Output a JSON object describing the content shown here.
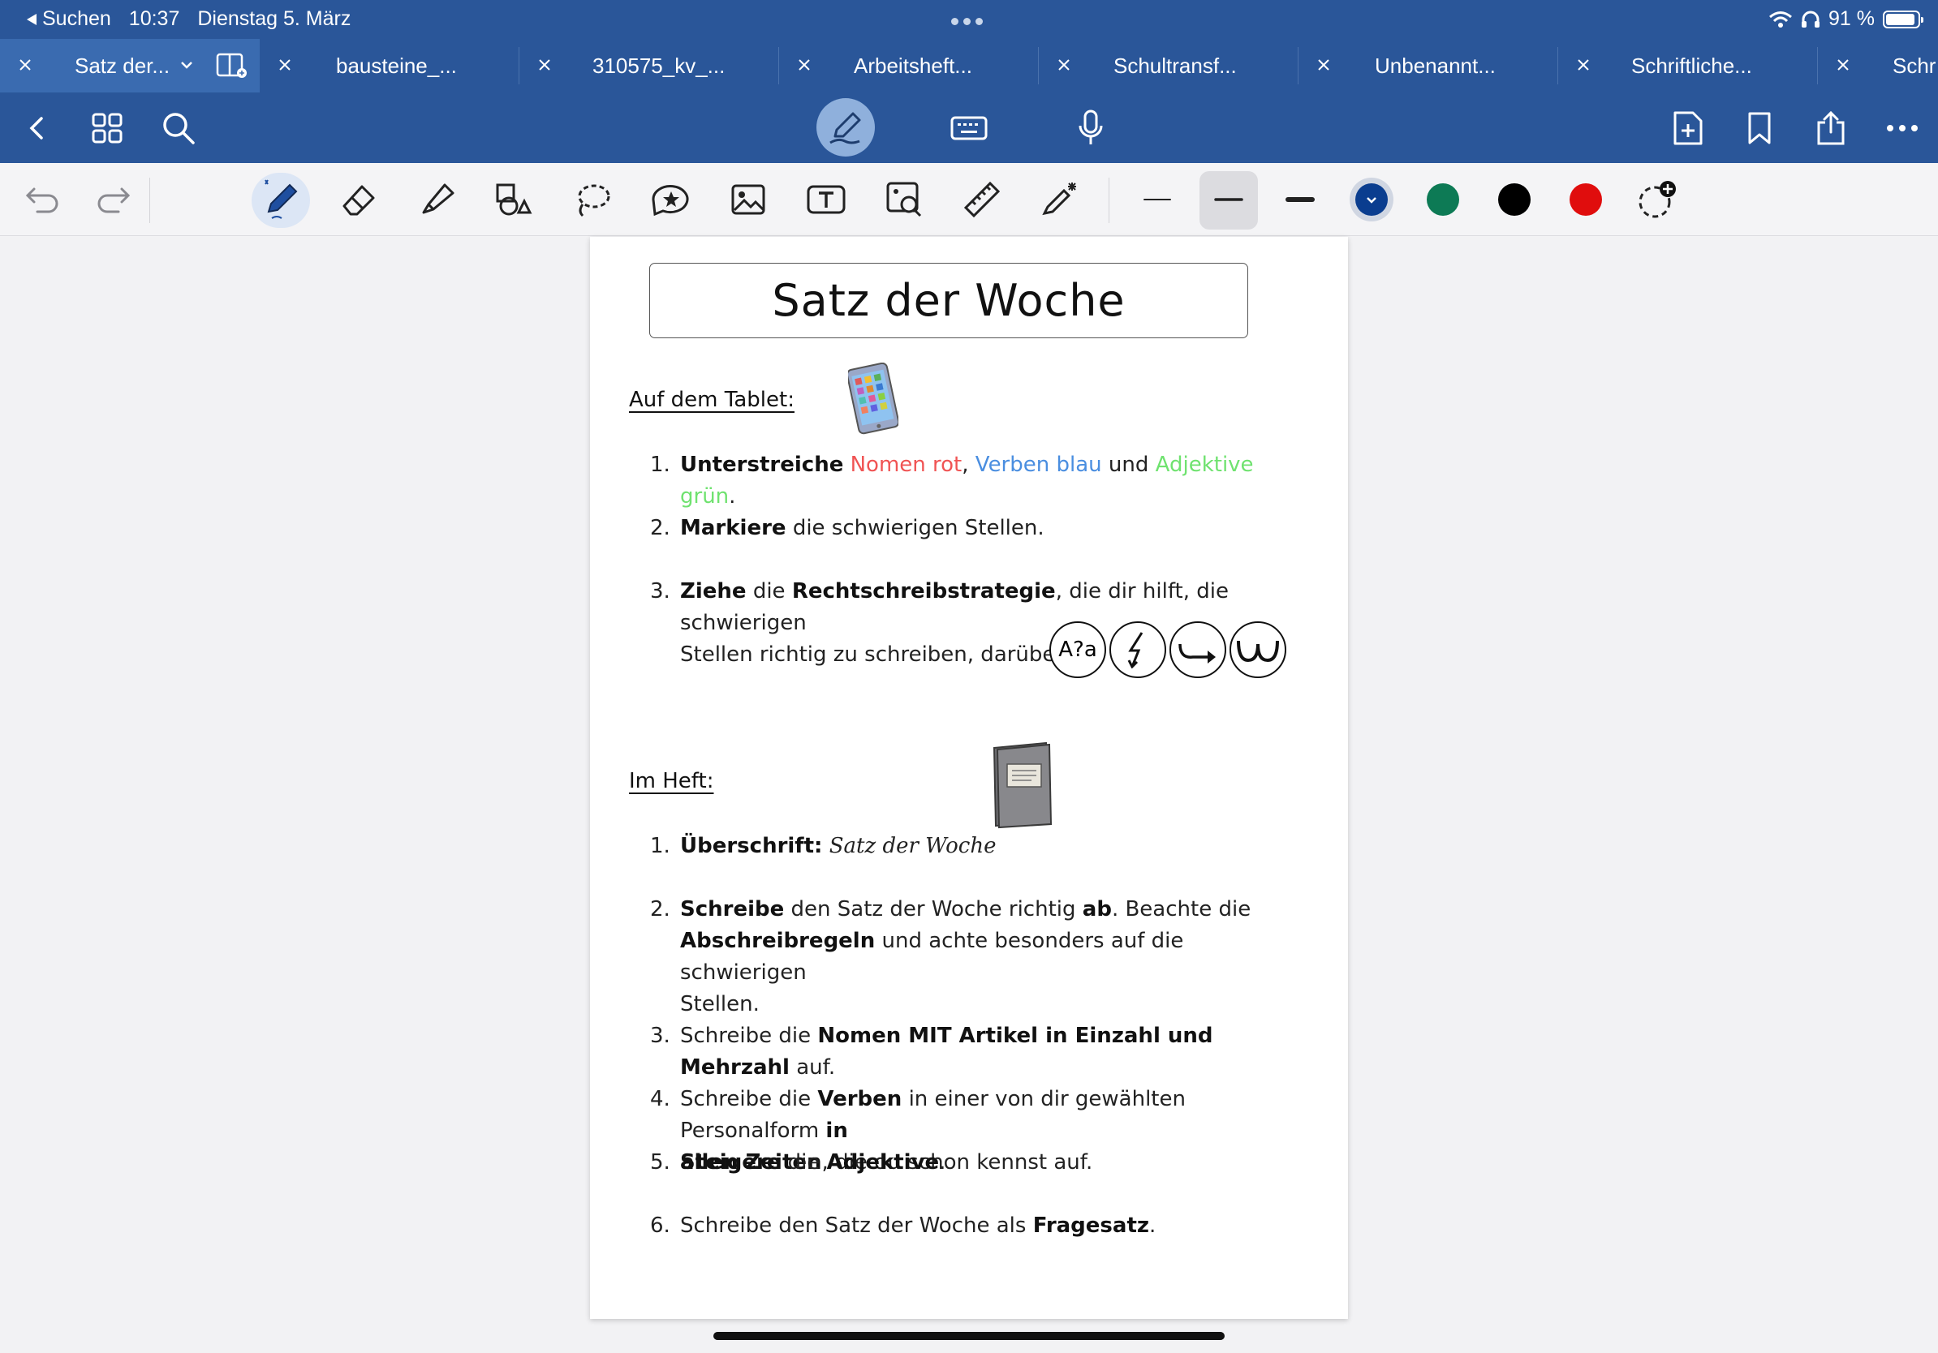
{
  "status": {
    "back_label": "Suchen",
    "time": "10:37",
    "date": "Dienstag 5. März",
    "battery": "91 %",
    "battery_level": 0.91
  },
  "tabs": [
    {
      "label": "Satz der..."
    },
    {
      "label": "bausteine_..."
    },
    {
      "label": "310575_kv_..."
    },
    {
      "label": "Arbeitsheft..."
    },
    {
      "label": "Schultransf..."
    },
    {
      "label": "Unbenannt..."
    },
    {
      "label": "Schriftliche..."
    },
    {
      "label": "Schr"
    }
  ],
  "colors": {
    "app_blue": "#2a5699",
    "swatch_blue": "#0a3d8f",
    "swatch_green": "#0d7a55",
    "swatch_black": "#000000",
    "swatch_red": "#e00d0d"
  },
  "document": {
    "title": "Satz der Woche",
    "section_tablet": "Auf dem Tablet:",
    "tablet_items": {
      "i1": {
        "num": "1.",
        "verb": "Unterstreiche",
        "nomen": "Nomen rot",
        "comma": ",",
        "verben": "Verben blau",
        "und": "und",
        "adj": "Adjektive grün",
        "end": "."
      },
      "i2": {
        "num": "2.",
        "verb": "Markiere",
        "rest": "die schwierigen Stellen."
      },
      "i3": {
        "num": "3.",
        "verb": "Ziehe",
        "a": "die",
        "strategy": "Rechtschreibstrategie",
        "rest1": ", die dir hilft, die schwierigen",
        "rest2": "Stellen richtig zu schreiben, darüber."
      }
    },
    "strategy_symbols": [
      "A?a",
      "⚡",
      "↪",
      "ω"
    ],
    "section_heft": "Im Heft:",
    "heft_items": {
      "i1": {
        "num": "1.",
        "label": "Überschrift:",
        "script": "Satz der Woche"
      },
      "i2": {
        "num": "2.",
        "verb": "Schreibe",
        "a": "den Satz der Woche richtig",
        "ab": "ab",
        "b": ". Beachte die",
        "rules": "Abschreibregeln",
        "c": "und achte besonders auf die schwierigen",
        "d": "Stellen."
      },
      "i3": {
        "num": "3.",
        "a": "Schreibe die",
        "bold": "Nomen MIT Artikel in Einzahl und Mehrzahl",
        "b": "auf."
      },
      "i4": {
        "num": "4.",
        "a": "Schreibe die",
        "verben": "Verben",
        "b": "in einer von dir gewählten Personalform",
        "in": "in",
        "allen": "allen Zeiten",
        "c": ", die du schon kennst auf."
      },
      "i5": {
        "num": "5.",
        "verb": "Steigere",
        "a": "die",
        "adj": "Adjektive",
        "b": "."
      },
      "i6": {
        "num": "6.",
        "a": "Schreibe den Satz der Woche als",
        "bold": "Fragesatz",
        "b": "."
      }
    }
  }
}
